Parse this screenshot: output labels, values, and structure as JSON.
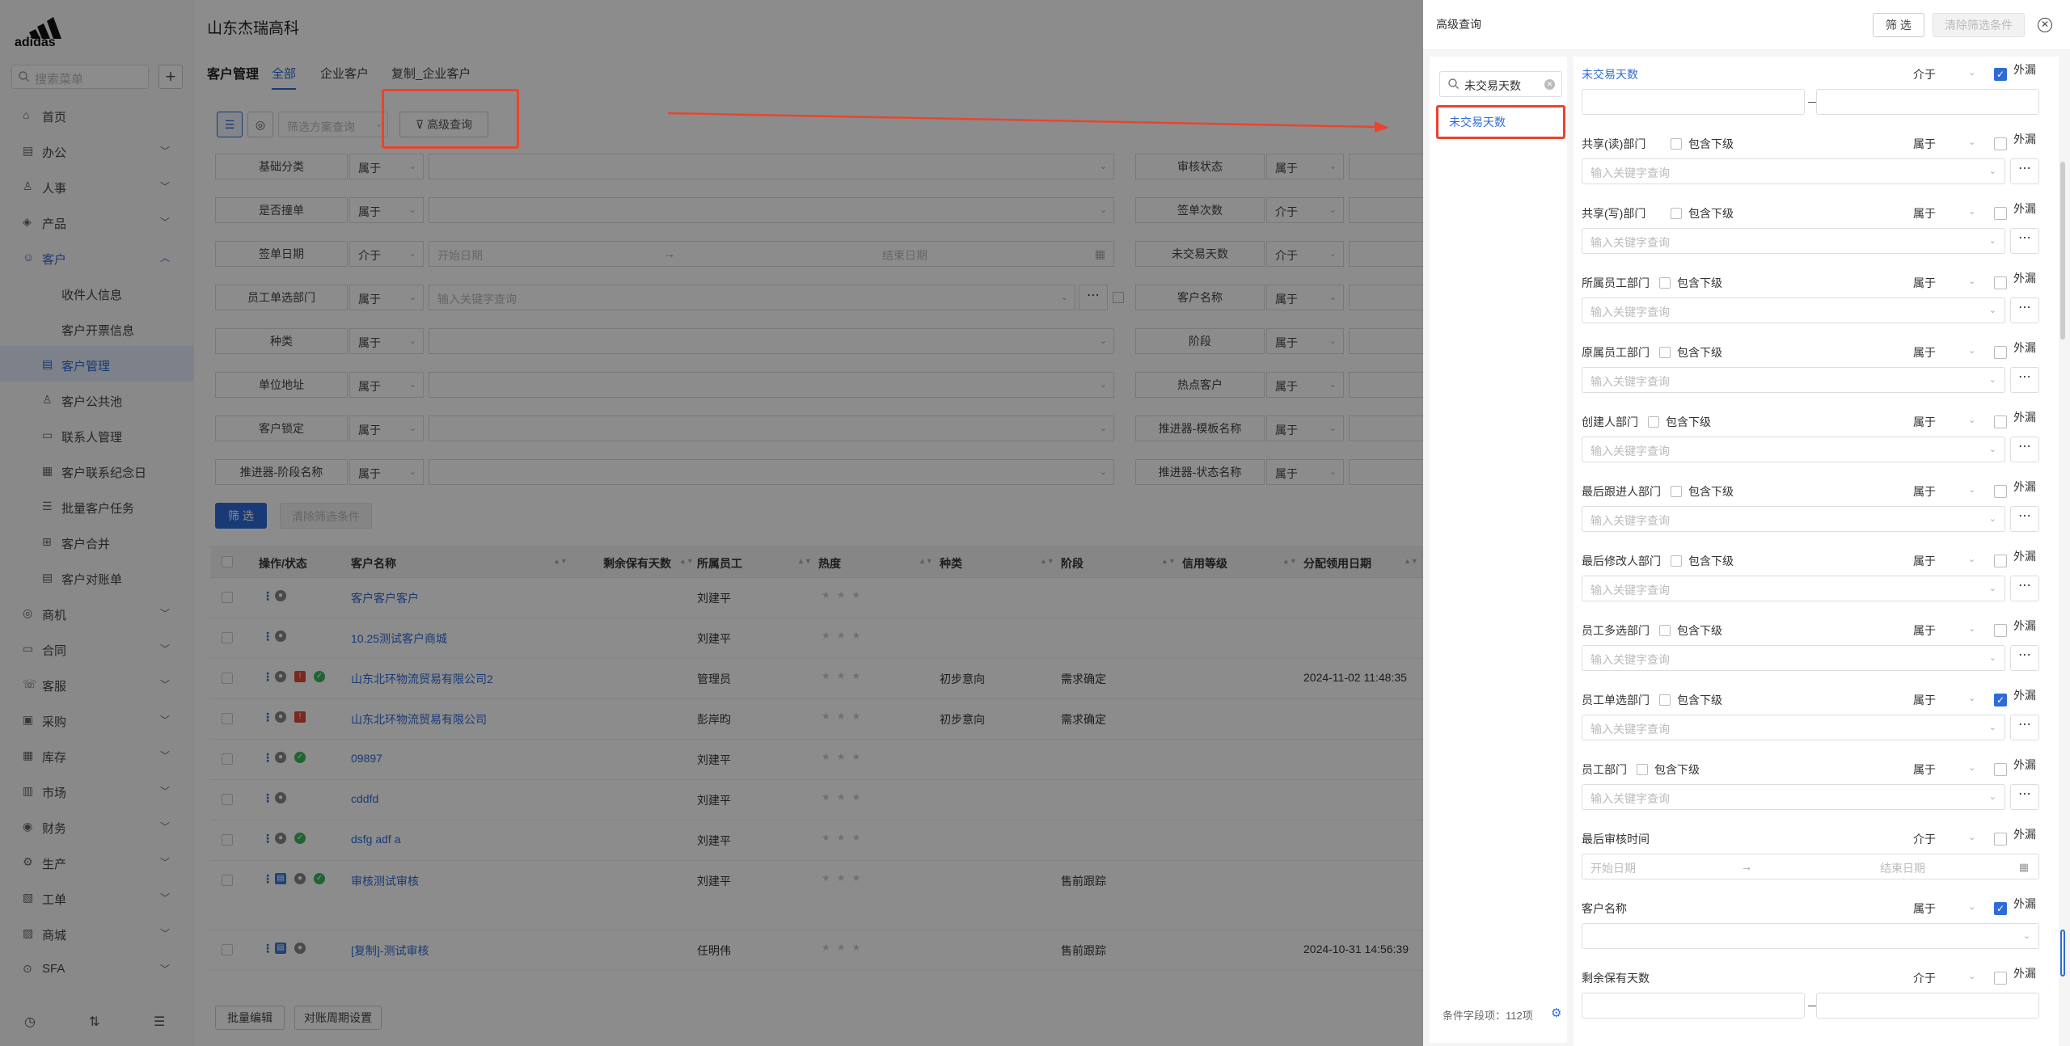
{
  "app": {
    "company": "山东杰瑞高科",
    "logo_text": "adidas"
  },
  "sidebar": {
    "search_placeholder": "搜索菜单",
    "items": [
      {
        "label": "首页",
        "icon": "home-icon",
        "chevron": false
      },
      {
        "label": "办公",
        "icon": "office-icon",
        "chevron": true
      },
      {
        "label": "人事",
        "icon": "people-icon",
        "chevron": true
      },
      {
        "label": "产品",
        "icon": "product-icon",
        "chevron": true
      },
      {
        "label": "客户",
        "icon": "customer-icon",
        "chevron": true,
        "open": true
      },
      {
        "label": "收件人信息",
        "sub": true
      },
      {
        "label": "客户开票信息",
        "sub": true
      },
      {
        "label": "客户管理",
        "sub": true,
        "active": true,
        "icon": "customer-mgmt-icon"
      },
      {
        "label": "客户公共池",
        "sub": true,
        "icon": "pool-icon"
      },
      {
        "label": "联系人管理",
        "sub": true,
        "icon": "contact-icon"
      },
      {
        "label": "客户联系纪念日",
        "sub": true,
        "icon": "calendar-icon"
      },
      {
        "label": "批量客户任务",
        "sub": true,
        "icon": "task-icon"
      },
      {
        "label": "客户合并",
        "sub": true,
        "icon": "merge-icon"
      },
      {
        "label": "客户对账单",
        "sub": true,
        "icon": "statement-icon"
      },
      {
        "label": "商机",
        "icon": "opportunity-icon",
        "chevron": true
      },
      {
        "label": "合同",
        "icon": "contract-icon",
        "chevron": true
      },
      {
        "label": "客服",
        "icon": "service-icon",
        "chevron": true
      },
      {
        "label": "采购",
        "icon": "purchase-icon",
        "chevron": true
      },
      {
        "label": "库存",
        "icon": "inventory-icon",
        "chevron": true
      },
      {
        "label": "市场",
        "icon": "market-icon",
        "chevron": true
      },
      {
        "label": "财务",
        "icon": "finance-icon",
        "chevron": true
      },
      {
        "label": "生产",
        "icon": "production-icon",
        "chevron": true
      },
      {
        "label": "工单",
        "icon": "workorder-icon",
        "chevron": true
      },
      {
        "label": "商城",
        "icon": "mall-icon",
        "chevron": true
      },
      {
        "label": "SFA",
        "icon": "sfa-icon",
        "chevron": true
      }
    ]
  },
  "main": {
    "module_title": "客户管理",
    "tabs": [
      "全部",
      "企业客户",
      "复制_企业客户"
    ],
    "plan_placeholder": "筛选方案查询",
    "adv_query_label": "高级查询",
    "filters": [
      {
        "label": "基础分类",
        "op": "属于",
        "value": "",
        "label2": "审核状态",
        "op2": "属于"
      },
      {
        "label": "是否撞单",
        "op": "属于",
        "value": "",
        "label2": "签单次数",
        "op2": "介于"
      },
      {
        "label": "签单日期",
        "op": "介于",
        "value": "开始日期",
        "value_end": "结束日期",
        "label2": "未交易天数",
        "op2": "介于"
      },
      {
        "label": "员工单选部门",
        "op": "属于",
        "value": "输入关键字查询",
        "more": true,
        "label2": "客户名称",
        "op2": "属于"
      },
      {
        "label": "种类",
        "op": "属于",
        "value": "",
        "label2": "阶段",
        "op2": "属于"
      },
      {
        "label": "单位地址",
        "op": "属于",
        "value": "",
        "label2": "热点客户",
        "op2": "属于"
      },
      {
        "label": "客户锁定",
        "op": "属于",
        "value": "",
        "label2": "推进器-模板名称",
        "op2": "属于"
      },
      {
        "label": "推进器-阶段名称",
        "op": "属于",
        "value": "",
        "label2": "推进器-状态名称",
        "op2": "属于"
      }
    ],
    "filter_btn": "筛 选",
    "clear_btn": "清除筛选条件",
    "table": {
      "headers": [
        "操作/状态",
        "客户名称",
        "剩余保有天数",
        "所属员工",
        "热度",
        "种类",
        "阶段",
        "信用等级",
        "分配领用日期"
      ],
      "rows": [
        {
          "name": "客户客户客户",
          "staff": "刘建平",
          "kind": "",
          "stage": "",
          "date": "",
          "icons": [
            "user"
          ]
        },
        {
          "name": "10.25测试客户商城",
          "staff": "刘建平",
          "kind": "",
          "stage": "",
          "date": "",
          "icons": [
            "user"
          ]
        },
        {
          "name": "山东北环物流贸易有限公司2",
          "staff": "管理员",
          "kind": "初步意向",
          "stage": "需求确定",
          "date": "2024-11-02 11:48:35",
          "icons": [
            "user",
            "red",
            "green"
          ]
        },
        {
          "name": "山东北环物流贸易有限公司",
          "staff": "彭岸昀",
          "kind": "初步意向",
          "stage": "需求确定",
          "date": "",
          "icons": [
            "user",
            "red"
          ]
        },
        {
          "name": "09897",
          "staff": "刘建平",
          "kind": "",
          "stage": "",
          "date": "",
          "icons": [
            "user",
            "green"
          ]
        },
        {
          "name": "cddfd",
          "staff": "刘建平",
          "kind": "",
          "stage": "",
          "date": "",
          "icons": [
            "user"
          ]
        },
        {
          "name": "dsfg adf a",
          "staff": "刘建平",
          "kind": "",
          "stage": "",
          "date": "",
          "icons": [
            "user",
            "green"
          ]
        },
        {
          "name": "审核测试审核",
          "staff": "刘建平",
          "kind": "",
          "stage": "售前跟踪",
          "date": "",
          "icons": [
            "blue",
            "user",
            "green"
          ]
        },
        {
          "name": "[复制]-测试审核",
          "staff": "任明伟",
          "kind": "",
          "stage": "售前跟踪",
          "date": "2024-10-31 14:56:39",
          "icons": [
            "blue",
            "user"
          ]
        }
      ]
    },
    "bottom_buttons": [
      "批量编辑",
      "对账周期设置"
    ]
  },
  "drawer": {
    "title": "高级查询",
    "filter_btn": "筛 选",
    "clear_btn": "清除筛选条件",
    "search_value": "未交易天数",
    "search_hit": "未交易天数",
    "footer": "条件字段项：112项",
    "include_sub_label": "包含下级",
    "ext_label": "外漏",
    "conditions": [
      {
        "label": "未交易天数",
        "op": "介于",
        "type": "range",
        "ext": true,
        "highlight": true
      },
      {
        "label": "共享(读)部门",
        "op": "属于",
        "type": "select_more",
        "include": true,
        "ext": false,
        "placeholder": "输入关键字查询"
      },
      {
        "label": "共享(写)部门",
        "op": "属于",
        "type": "select_more",
        "include": true,
        "ext": false,
        "placeholder": "输入关键字查询"
      },
      {
        "label": "所属员工部门",
        "op": "属于",
        "type": "select_more",
        "include": true,
        "ext": false,
        "placeholder": "输入关键字查询"
      },
      {
        "label": "原属员工部门",
        "op": "属于",
        "type": "select_more",
        "include": true,
        "ext": false,
        "placeholder": "输入关键字查询"
      },
      {
        "label": "创建人部门",
        "op": "属于",
        "type": "select_more",
        "include": true,
        "ext": false,
        "placeholder": "输入关键字查询"
      },
      {
        "label": "最后跟进人部门",
        "op": "属于",
        "type": "select_more",
        "include": true,
        "ext": false,
        "placeholder": "输入关键字查询"
      },
      {
        "label": "最后修改人部门",
        "op": "属于",
        "type": "select_more",
        "include": true,
        "ext": false,
        "placeholder": "输入关键字查询"
      },
      {
        "label": "员工多选部门",
        "op": "属于",
        "type": "select_more",
        "include": true,
        "ext": false,
        "placeholder": "输入关键字查询"
      },
      {
        "label": "员工单选部门",
        "op": "属于",
        "type": "select_more",
        "include": true,
        "ext": true,
        "placeholder": "输入关键字查询"
      },
      {
        "label": "员工部门",
        "op": "属于",
        "type": "select_more",
        "include": true,
        "ext": false,
        "placeholder": "输入关键字查询"
      },
      {
        "label": "最后审核时间",
        "op": "介于",
        "type": "date",
        "ext": false,
        "start": "开始日期",
        "end": "结束日期"
      },
      {
        "label": "客户名称",
        "op": "属于",
        "type": "select",
        "ext": true,
        "placeholder": ""
      },
      {
        "label": "剩余保有天数",
        "op": "介于",
        "type": "range",
        "ext": false
      }
    ]
  }
}
